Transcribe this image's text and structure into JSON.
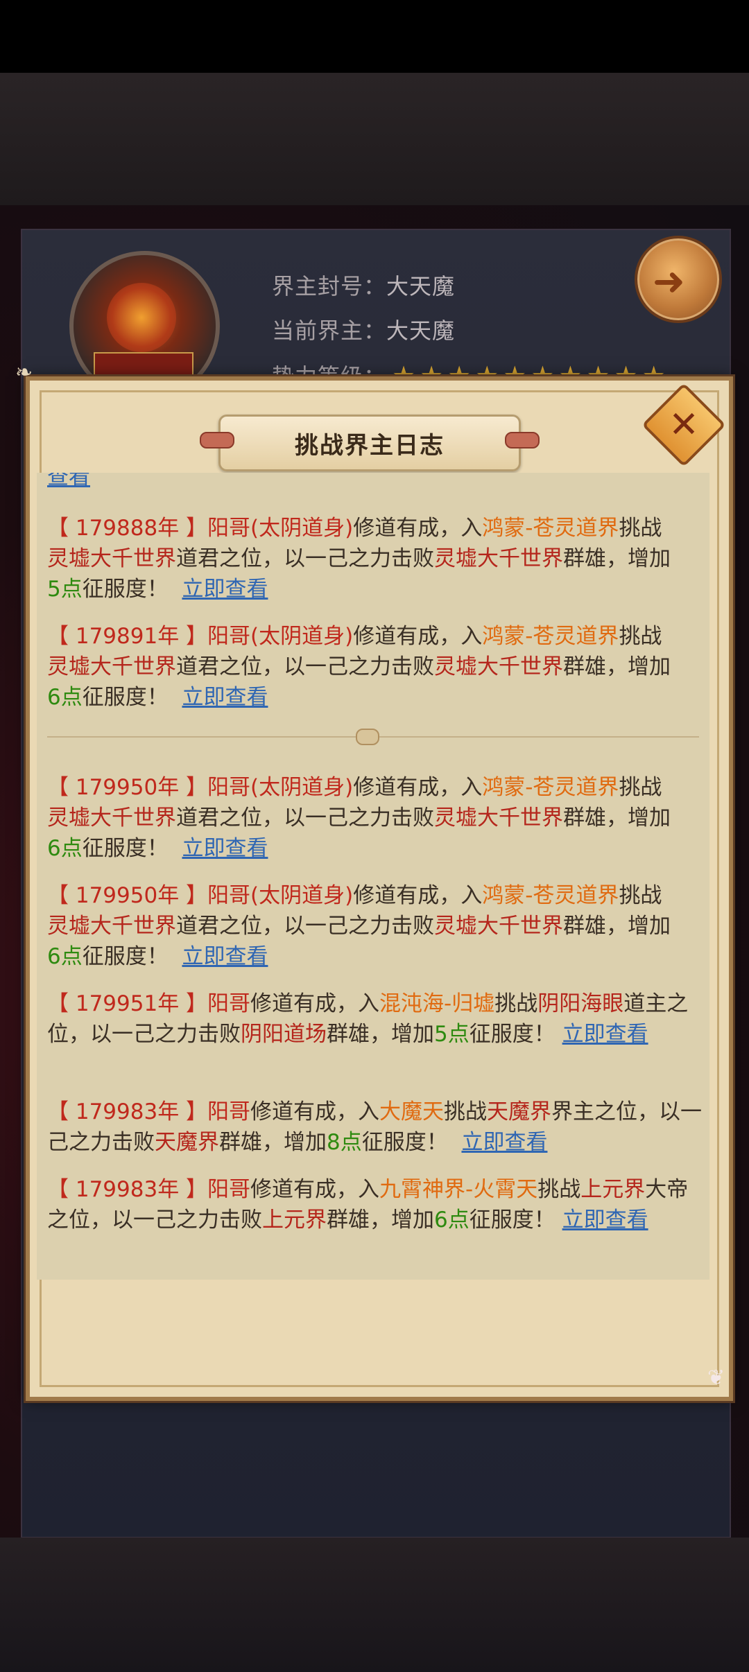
{
  "header": {
    "title_label": "界主封号：",
    "title_value": "大天魔",
    "lord_label": "当前界主：",
    "lord_value": "大天魔",
    "level_label": "势力等级：",
    "stars": "★★★★★★★★★★"
  },
  "modal": {
    "title": "挑战界主日志",
    "top_clip": "查看"
  },
  "entries": [
    {
      "year": "【 179888年 】",
      "player": "阳哥(太阴道身)",
      "t1": "修道有成，入",
      "place": "鸿蒙-苍灵道界",
      "t2": "挑战",
      "target": "灵墟大千世界",
      "t3": "道君之位，以一己之力击败",
      "defeated": "灵墟大千世界",
      "t4": "群雄，增加",
      "points": "5点",
      "t5": "征服度！",
      "link": "立即查看"
    },
    {
      "year": "【 179891年 】",
      "player": "阳哥(太阴道身)",
      "t1": "修道有成，入",
      "place": "鸿蒙-苍灵道界",
      "t2": "挑战",
      "target": "灵墟大千世界",
      "t3": "道君之位，以一己之力击败",
      "defeated": "灵墟大千世界",
      "t4": "群雄，增加",
      "points": "6点",
      "t5": "征服度！",
      "link": "立即查看"
    },
    {
      "year": "【 179950年 】",
      "player": "阳哥(太阴道身)",
      "t1": "修道有成，入",
      "place": "鸿蒙-苍灵道界",
      "t2": "挑战",
      "target": "灵墟大千世界",
      "t3": "道君之位，以一己之力击败",
      "defeated": "灵墟大千世界",
      "t4": "群雄，增加",
      "points": "6点",
      "t5": "征服度！",
      "link": "立即查看"
    },
    {
      "year": "【 179950年 】",
      "player": "阳哥(太阴道身)",
      "t1": "修道有成，入",
      "place": "鸿蒙-苍灵道界",
      "t2": "挑战",
      "target": "灵墟大千世界",
      "t3": "道君之位，以一己之力击败",
      "defeated": "灵墟大千世界",
      "t4": "群雄，增加",
      "points": "6点",
      "t5": "征服度！",
      "link": "立即查看"
    },
    {
      "year": "【 179951年 】",
      "player": "阳哥",
      "t1": "修道有成，入",
      "place": "混沌海-归墟",
      "t2": "挑战",
      "target": "阴阳海眼",
      "t3": "道主之位，以一己之力击败",
      "defeated": "阴阳道场",
      "t4": "群雄，增加",
      "points": "5点",
      "t5": "征服度！",
      "link": "立即查看"
    },
    {
      "year": "【 179983年 】",
      "player": "阳哥",
      "t1": "修道有成，入",
      "place": "大魔天",
      "t2": "挑战",
      "target": "天魔界",
      "t3": "界主之位，以一己之力击败",
      "defeated": "天魔界",
      "t4": "群雄，增加",
      "points": "8点",
      "t5": "征服度！",
      "link": "立即查看"
    },
    {
      "year": "【 179983年 】",
      "player": "阳哥",
      "t1": "修道有成，入",
      "place": "九霄神界-火霄天",
      "t2": "挑战",
      "target": "上元界",
      "t3": "大帝之位，以一己之力击败",
      "defeated": "上元界",
      "t4": "群雄，增加",
      "points": "6点",
      "t5": "征服度！",
      "link": "立即查看"
    }
  ]
}
